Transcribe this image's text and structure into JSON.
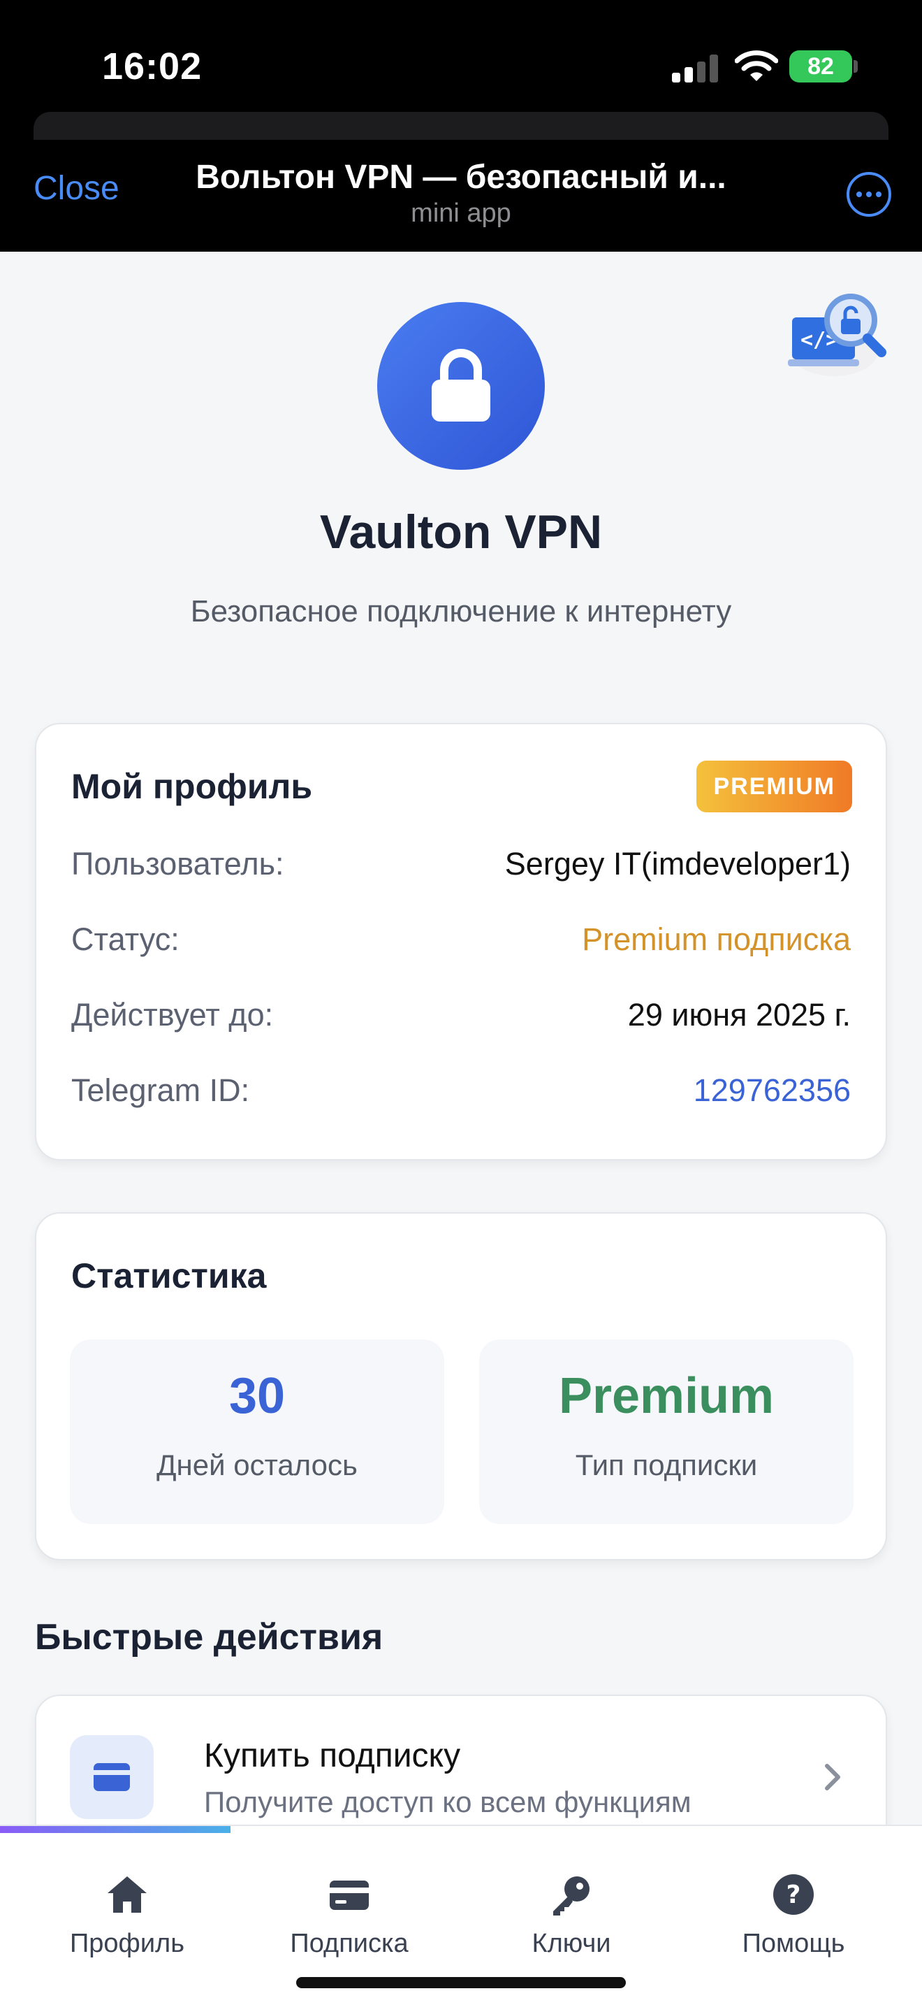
{
  "status_bar": {
    "time": "16:02",
    "battery": "82"
  },
  "telegram_header": {
    "close_label": "Close",
    "title": "Вольтон VPN — безопасный и...",
    "subtitle": "mini app"
  },
  "app": {
    "name": "Vaulton VPN",
    "tagline": "Безопасное подключение к интернету",
    "logo_icon": "lock-icon",
    "brand_color": "#3b66e3"
  },
  "profile": {
    "title": "Мой профиль",
    "badge": "PREMIUM",
    "rows": [
      {
        "label": "Пользователь:",
        "value": "Sergey IT(imdeveloper1)"
      },
      {
        "label": "Статус:",
        "value": "Premium подписка"
      },
      {
        "label": "Действует до:",
        "value": "29 июня 2025 г."
      },
      {
        "label": "Telegram ID:",
        "value": "129762356"
      }
    ]
  },
  "stats": {
    "title": "Статистика",
    "items": [
      {
        "value": "30",
        "label": "Дней осталось",
        "color": "#3a63d6"
      },
      {
        "value": "Premium",
        "label": "Тип подписки",
        "color": "#3b8f5e"
      }
    ]
  },
  "quick_actions": {
    "title": "Быстрые действия",
    "items": [
      {
        "title": "Купить подписку",
        "description": "Получите доступ ко всем функциям",
        "icon": "credit-card-icon"
      }
    ]
  },
  "bottom_nav": {
    "items": [
      {
        "label": "Профиль",
        "icon": "home-icon"
      },
      {
        "label": "Подписка",
        "icon": "credit-card-icon"
      },
      {
        "label": "Ключи",
        "icon": "key-icon"
      },
      {
        "label": "Помощь",
        "icon": "help-icon"
      }
    ],
    "loading_progress": 0.25
  }
}
